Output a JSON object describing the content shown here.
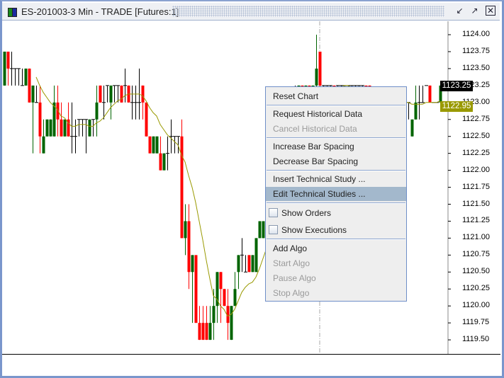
{
  "window": {
    "title": "ES-201003-3 Min - TRADE [Futures:1]",
    "icons": [
      "candlestick-icon",
      "minimize-icon",
      "maximize-icon",
      "close-icon"
    ]
  },
  "price_axis": {
    "labels": [
      "1124.00",
      "1123.75",
      "1123.50",
      "1123.25",
      "1123.00",
      "1122.75",
      "1122.50",
      "1122.25",
      "1122.00",
      "1121.75",
      "1121.50",
      "1121.25",
      "1121.00",
      "1120.75",
      "1120.50",
      "1120.25",
      "1120.00",
      "1119.75",
      "1119.50"
    ],
    "last_price": "1123.25",
    "study_value": "1122.95"
  },
  "colors": {
    "up": "#006400",
    "down": "#ff0000",
    "doji": "#000000",
    "study": "#999900",
    "menu_highlight": "#a3b8cc"
  },
  "context_menu": {
    "items": [
      {
        "label": "Reset Chart",
        "enabled": true
      },
      {
        "label": "Request Historical Data",
        "enabled": true
      },
      {
        "label": "Cancel Historical Data",
        "enabled": false
      },
      {
        "label": "Increase Bar Spacing",
        "enabled": true
      },
      {
        "label": "Decrease Bar Spacing",
        "enabled": true
      },
      {
        "label": "Insert Technical Study ...",
        "enabled": true
      },
      {
        "label": "Edit Technical Studies ...",
        "enabled": true,
        "highlighted": true
      },
      {
        "label": "Show Orders",
        "checkbox": true,
        "checked": false
      },
      {
        "label": "Show Executions",
        "checkbox": true,
        "checked": false
      },
      {
        "label": "Add Algo",
        "enabled": true
      },
      {
        "label": "Start Algo",
        "enabled": false
      },
      {
        "label": "Pause Algo",
        "enabled": false
      },
      {
        "label": "Stop Algo",
        "enabled": false
      }
    ]
  },
  "chart_data": {
    "type": "candlestick",
    "ylim": [
      1119.5,
      1124.0
    ],
    "study": "moving-average",
    "bars_ohlc": [
      [
        1123.25,
        1123.75,
        1123.25,
        1123.75
      ],
      [
        1123.75,
        1123.75,
        1123.25,
        1123.5
      ],
      [
        1123.5,
        1123.75,
        1123.25,
        1123.5
      ],
      [
        1123.5,
        1123.5,
        1123.25,
        1123.5
      ],
      [
        1123.5,
        1123.5,
        1123.25,
        1123.5
      ],
      [
        1123.25,
        1123.5,
        1123.25,
        1123.25
      ],
      [
        1123.25,
        1123.5,
        1123.25,
        1123.5
      ],
      [
        1123.5,
        1123.5,
        1123.0,
        1123.0
      ],
      [
        1123.0,
        1123.25,
        1122.25,
        1123.25
      ],
      [
        1123.0,
        1123.25,
        1123.0,
        1123.0
      ],
      [
        1123.0,
        1123.25,
        1122.25,
        1122.5
      ],
      [
        1122.25,
        1122.75,
        1122.25,
        1122.5
      ],
      [
        1122.5,
        1122.75,
        1122.5,
        1122.75
      ],
      [
        1122.5,
        1122.75,
        1122.5,
        1122.75
      ],
      [
        1122.5,
        1123.25,
        1122.5,
        1123.0
      ],
      [
        1123.0,
        1123.25,
        1122.5,
        1122.75
      ],
      [
        1122.75,
        1123.0,
        1122.5,
        1122.5
      ],
      [
        1122.5,
        1122.75,
        1122.5,
        1122.75
      ],
      [
        1122.75,
        1123.0,
        1122.5,
        1122.5
      ],
      [
        1122.5,
        1123.0,
        1122.25,
        1122.5
      ],
      [
        1122.5,
        1122.75,
        1122.25,
        1122.5
      ],
      [
        1122.75,
        1122.75,
        1122.5,
        1122.75
      ],
      [
        1122.75,
        1122.75,
        1122.5,
        1122.75
      ],
      [
        1122.75,
        1122.75,
        1122.25,
        1122.75
      ],
      [
        1122.5,
        1122.75,
        1122.5,
        1122.75
      ],
      [
        1122.75,
        1122.75,
        1122.5,
        1122.75
      ],
      [
        1122.75,
        1123.25,
        1122.5,
        1123.0
      ],
      [
        1123.25,
        1123.25,
        1123.0,
        1123.0
      ],
      [
        1123.0,
        1123.25,
        1122.75,
        1123.0
      ],
      [
        1123.25,
        1123.25,
        1123.0,
        1123.25
      ],
      [
        1123.0,
        1123.25,
        1122.75,
        1123.25
      ],
      [
        1123.25,
        1123.25,
        1123.0,
        1123.25
      ],
      [
        1123.25,
        1123.25,
        1123.0,
        1123.25
      ],
      [
        1123.25,
        1123.25,
        1123.0,
        1123.0
      ],
      [
        1123.25,
        1123.5,
        1123.0,
        1123.25
      ],
      [
        1123.25,
        1123.25,
        1123.0,
        1123.0
      ],
      [
        1123.0,
        1123.25,
        1122.75,
        1123.0
      ],
      [
        1123.0,
        1123.25,
        1122.75,
        1123.0
      ],
      [
        1123.0,
        1123.5,
        1122.75,
        1123.0
      ],
      [
        1123.25,
        1123.25,
        1122.75,
        1123.0
      ],
      [
        1123.0,
        1123.0,
        1122.5,
        1122.5
      ],
      [
        1122.5,
        1122.5,
        1122.25,
        1122.25
      ],
      [
        1122.25,
        1122.5,
        1122.25,
        1122.5
      ],
      [
        1122.25,
        1122.5,
        1122.25,
        1122.5
      ],
      [
        1122.25,
        1122.5,
        1122.0,
        1122.0
      ],
      [
        1122.0,
        1122.25,
        1122.0,
        1122.25
      ],
      [
        1122.25,
        1122.5,
        1122.0,
        1122.25
      ],
      [
        1122.5,
        1122.75,
        1122.25,
        1122.5
      ],
      [
        1122.5,
        1122.5,
        1122.25,
        1122.5
      ],
      [
        1122.5,
        1122.5,
        1122.25,
        1122.5
      ],
      [
        1122.5,
        1122.75,
        1121.0,
        1121.0
      ],
      [
        1121.0,
        1121.5,
        1120.75,
        1121.25
      ],
      [
        1121.25,
        1121.5,
        1120.25,
        1120.5
      ],
      [
        1120.5,
        1120.75,
        1119.75,
        1120.75
      ],
      [
        1120.75,
        1120.75,
        1119.75,
        1119.75
      ],
      [
        1119.75,
        1120.0,
        1119.5,
        1119.5
      ],
      [
        1119.75,
        1120.0,
        1119.5,
        1119.5
      ],
      [
        1119.75,
        1120.0,
        1119.5,
        1119.5
      ],
      [
        1119.5,
        1120.0,
        1119.5,
        1119.75
      ],
      [
        1119.75,
        1120.25,
        1119.5,
        1120.0
      ],
      [
        1120.0,
        1120.5,
        1119.75,
        1120.5
      ],
      [
        1120.5,
        1120.5,
        1119.75,
        1120.25
      ],
      [
        1120.25,
        1120.25,
        1120.0,
        1120.0
      ],
      [
        1120.0,
        1120.25,
        1119.5,
        1119.75
      ],
      [
        1119.5,
        1120.0,
        1119.5,
        1120.0
      ],
      [
        1120.0,
        1120.5,
        1120.0,
        1120.25
      ],
      [
        1120.5,
        1120.75,
        1120.25,
        1120.75
      ],
      [
        1120.75,
        1121.0,
        1120.5,
        1120.75
      ],
      [
        1120.5,
        1120.75,
        1120.5,
        1120.5
      ],
      [
        1120.75,
        1120.75,
        1120.5,
        1120.5
      ],
      [
        1120.5,
        1120.75,
        1120.5,
        1120.75
      ],
      [
        1120.5,
        1121.0,
        1120.5,
        1121.0
      ],
      [
        1121.0,
        1121.25,
        1121.0,
        1121.25
      ],
      [
        1121.0,
        1121.25,
        1121.0,
        1121.25
      ],
      [
        1121.25,
        1121.5,
        1121.0,
        1121.5
      ],
      [
        1121.5,
        1121.75,
        1121.25,
        1121.75
      ],
      [
        1121.75,
        1122.0,
        1121.5,
        1122.0
      ],
      [
        1122.0,
        1122.25,
        1121.75,
        1122.0
      ],
      [
        1122.0,
        1122.5,
        1122.0,
        1122.5
      ],
      [
        1122.5,
        1122.75,
        1122.25,
        1122.75
      ],
      [
        1122.75,
        1123.0,
        1122.5,
        1122.75
      ],
      [
        1122.75,
        1123.0,
        1122.5,
        1123.0
      ],
      [
        1123.0,
        1123.25,
        1122.75,
        1123.0
      ],
      [
        1123.0,
        1123.25,
        1122.75,
        1123.25
      ],
      [
        1123.25,
        1123.25,
        1123.0,
        1123.0
      ],
      [
        1123.0,
        1123.25,
        1122.75,
        1123.25
      ],
      [
        1123.25,
        1123.25,
        1123.0,
        1123.0
      ],
      [
        1123.0,
        1123.25,
        1123.0,
        1123.25
      ],
      [
        1123.25,
        1124.0,
        1123.0,
        1123.5
      ],
      [
        1123.75,
        1123.75,
        1123.0,
        1123.25
      ],
      [
        1123.25,
        1123.25,
        1123.0,
        1123.25
      ],
      [
        1123.25,
        1123.25,
        1123.0,
        1123.25
      ],
      [
        1123.25,
        1123.25,
        1123.0,
        1123.25
      ],
      [
        1123.25,
        1123.25,
        1123.0,
        1123.0
      ],
      [
        1123.25,
        1123.25,
        1123.0,
        1123.25
      ],
      [
        1123.25,
        1123.25,
        1123.0,
        1123.25
      ],
      [
        1123.25,
        1123.25,
        1123.0,
        1123.25
      ],
      [
        1123.25,
        1123.25,
        1123.0,
        1123.25
      ],
      [
        1123.25,
        1123.25,
        1123.0,
        1123.25
      ],
      [
        1123.25,
        1123.25,
        1123.0,
        1123.25
      ],
      [
        1123.25,
        1123.25,
        1123.0,
        1123.25
      ],
      [
        1123.25,
        1123.25,
        1123.0,
        1123.25
      ],
      [
        1123.25,
        1123.25,
        1123.0,
        1123.0
      ],
      [
        1123.25,
        1123.25,
        1123.0,
        1123.0
      ],
      [
        1123.0,
        1123.0,
        1122.75,
        1123.0
      ],
      [
        1123.0,
        1123.0,
        1122.75,
        1123.0
      ],
      [
        1123.0,
        1123.0,
        1122.75,
        1123.0
      ],
      [
        1123.0,
        1123.0,
        1122.75,
        1123.0
      ],
      [
        1123.0,
        1123.0,
        1122.75,
        1123.0
      ],
      [
        1123.0,
        1123.0,
        1122.75,
        1123.0
      ],
      [
        1123.0,
        1123.0,
        1122.75,
        1123.0
      ],
      [
        1123.0,
        1123.0,
        1122.75,
        1123.0
      ],
      [
        1123.0,
        1123.0,
        1122.75,
        1123.0
      ],
      [
        1123.0,
        1123.0,
        1122.75,
        1123.0
      ],
      [
        1123.0,
        1123.0,
        1122.75,
        1123.0
      ],
      [
        1122.5,
        1122.75,
        1122.5,
        1122.75
      ],
      [
        1122.75,
        1123.25,
        1122.75,
        1123.0
      ],
      [
        1123.0,
        1123.25,
        1122.75,
        1123.0
      ],
      [
        1123.0,
        1123.25,
        1123.0,
        1123.0
      ],
      [
        1123.25,
        1123.25,
        1123.25,
        1123.25
      ],
      [
        1123.25,
        1123.25,
        1123.0,
        1123.0
      ],
      [
        1123.0,
        1123.0,
        1123.0,
        1123.0
      ],
      [
        1123.0,
        1123.0,
        1123.0,
        1123.0
      ],
      [
        1123.0,
        1123.25,
        1123.0,
        1123.25
      ]
    ]
  }
}
